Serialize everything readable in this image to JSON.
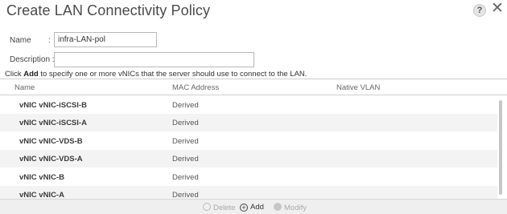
{
  "dialog": {
    "title": "Create LAN Connectivity Policy",
    "help_glyph": "?",
    "close_glyph": "✕"
  },
  "form": {
    "name_label": "Name",
    "name_colon": ":",
    "name_value": "infra-LAN-pol",
    "description_label": "Description :",
    "description_value": ""
  },
  "instructions": {
    "prefix": "Click ",
    "bold": "Add",
    "suffix": " to specify one or more vNICs that the server should use to connect to the LAN."
  },
  "table": {
    "columns": [
      "Name",
      "MAC Address",
      "Native VLAN"
    ],
    "rows": [
      {
        "name": "vNIC vNIC-iSCSI-B",
        "mac": "Derived",
        "vlan": ""
      },
      {
        "name": "vNIC vNIC-iSCSI-A",
        "mac": "Derived",
        "vlan": ""
      },
      {
        "name": "vNIC vNIC-VDS-B",
        "mac": "Derived",
        "vlan": ""
      },
      {
        "name": "vNIC vNIC-VDS-A",
        "mac": "Derived",
        "vlan": ""
      },
      {
        "name": "vNIC vNIC-B",
        "mac": "Derived",
        "vlan": ""
      },
      {
        "name": "vNIC vNIC-A",
        "mac": "Derived",
        "vlan": ""
      }
    ]
  },
  "footer": {
    "delete_label": "Delete",
    "add_label": "Add",
    "add_glyph": "+",
    "modify_label": "Modify"
  },
  "colors": {
    "row_alt": "#f3f3f3",
    "footer_bg": "#efefef",
    "disabled_text": "#aaaaaa"
  }
}
